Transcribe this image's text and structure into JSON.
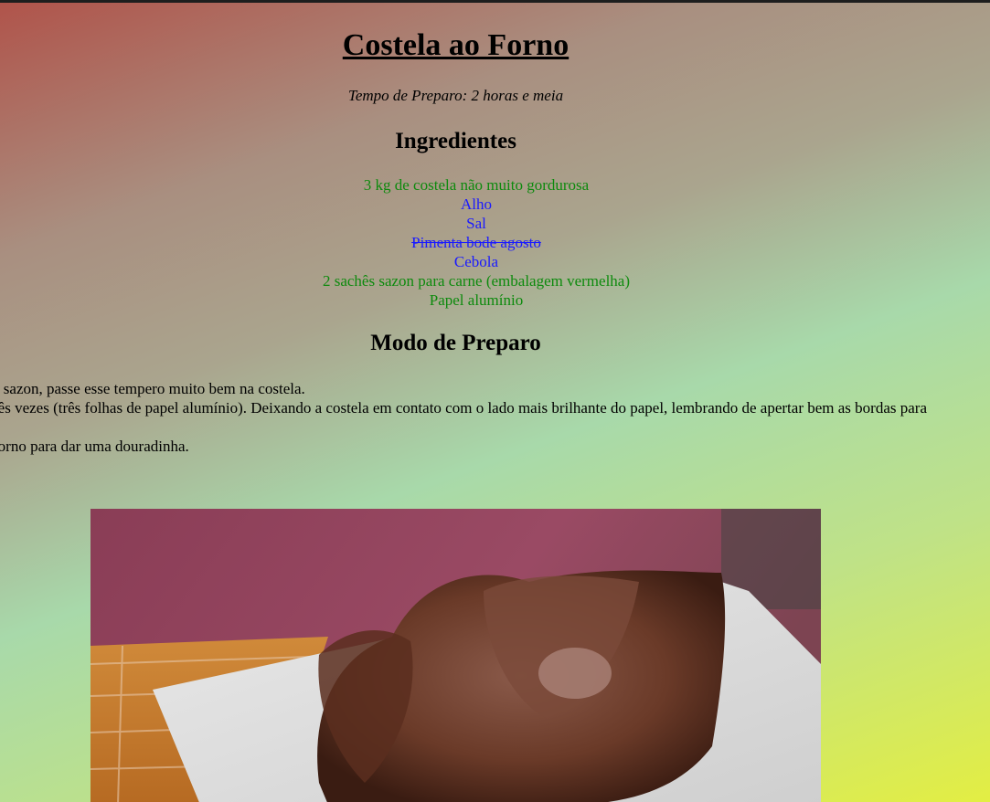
{
  "recipe": {
    "title": "Costela ao Forno",
    "prep_time": "Tempo de Preparo: 2 horas e meia",
    "ingredients_heading": "Ingredientes",
    "ingredients": [
      {
        "text": "3 kg de costela não muito gordurosa",
        "color": "#0d8a0d",
        "strikethrough": false
      },
      {
        "text": "Alho",
        "color": "#1a1aff",
        "strikethrough": false
      },
      {
        "text": "Sal",
        "color": "#1a1aff",
        "strikethrough": false
      },
      {
        "text": "Pimenta bode agosto",
        "color": "#1a1aff",
        "strikethrough": true
      },
      {
        "text": "Cebola",
        "color": "#1a1aff",
        "strikethrough": false
      },
      {
        "text": "2 sachês sazon para carne (embalagem vermelha)",
        "color": "#0d8a0d",
        "strikethrough": false
      },
      {
        "text": "Papel alumínio",
        "color": "#0d8a0d",
        "strikethrough": false
      }
    ],
    "method_heading": "Modo de Preparo",
    "steps": [
      "e sazon, passe esse tempero muito bem na costela.",
      "rês vezes (três folhas de papel alumínio). Deixando a costela em contato com o lado mais brilhante do papel, lembrando de apertar bem as bordas para",
      "",
      "forno para dar uma douradinha."
    ]
  }
}
